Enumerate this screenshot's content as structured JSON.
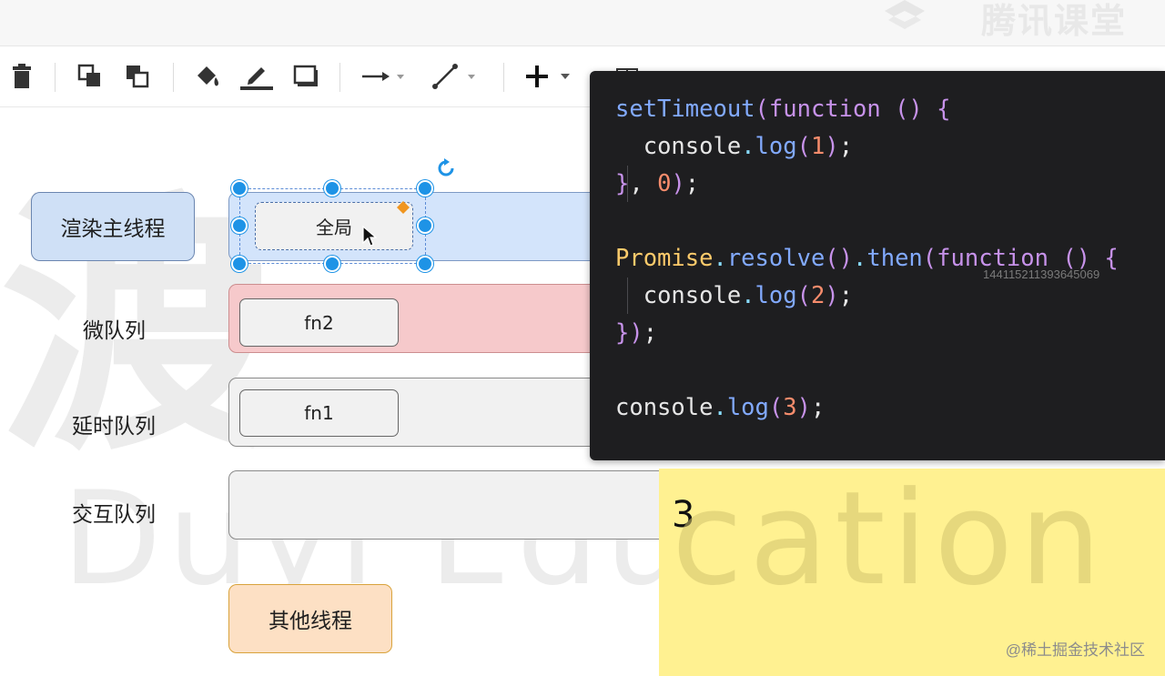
{
  "brand": {
    "watermark": "腾讯课堂"
  },
  "toolbar": {
    "items": [
      "delete-icon",
      "bring-to-front-icon",
      "send-to-back-icon",
      "fill-color-icon",
      "line-color-icon",
      "shadow-icon",
      "connection-icon",
      "waypoints-icon",
      "insert-icon",
      "table-icon"
    ]
  },
  "watermarks": {
    "han": "渡",
    "duyi": "Duyi  Edu",
    "cation": "cation"
  },
  "diagram": {
    "render_thread": "渲染主线程",
    "micro_queue": "微队列",
    "delay_queue": "延时队列",
    "interact_queue": "交互队列",
    "global_task": "全局",
    "fn2": "fn2",
    "fn1": "fn1",
    "other_threads": "其他线程"
  },
  "code": {
    "lines": [
      "setTimeout(function () {",
      "  console.log(1);",
      "}, 0);",
      "",
      "Promise.resolve().then(function () {",
      "  console.log(2);",
      "});",
      "",
      "console.log(3);"
    ],
    "stamp": "1441152113936450​69"
  },
  "output": {
    "value": "3"
  },
  "credit": "@稀土掘金技术社区",
  "colors": {
    "accent": "#1e93e6",
    "render_bg": "#cfe0f6",
    "micro_bg": "#f6c9cb",
    "queue_bg": "#f1f1f1",
    "other_bg": "#fde0c4",
    "output_bg": "#fff191",
    "code_bg": "#1e1e20"
  }
}
